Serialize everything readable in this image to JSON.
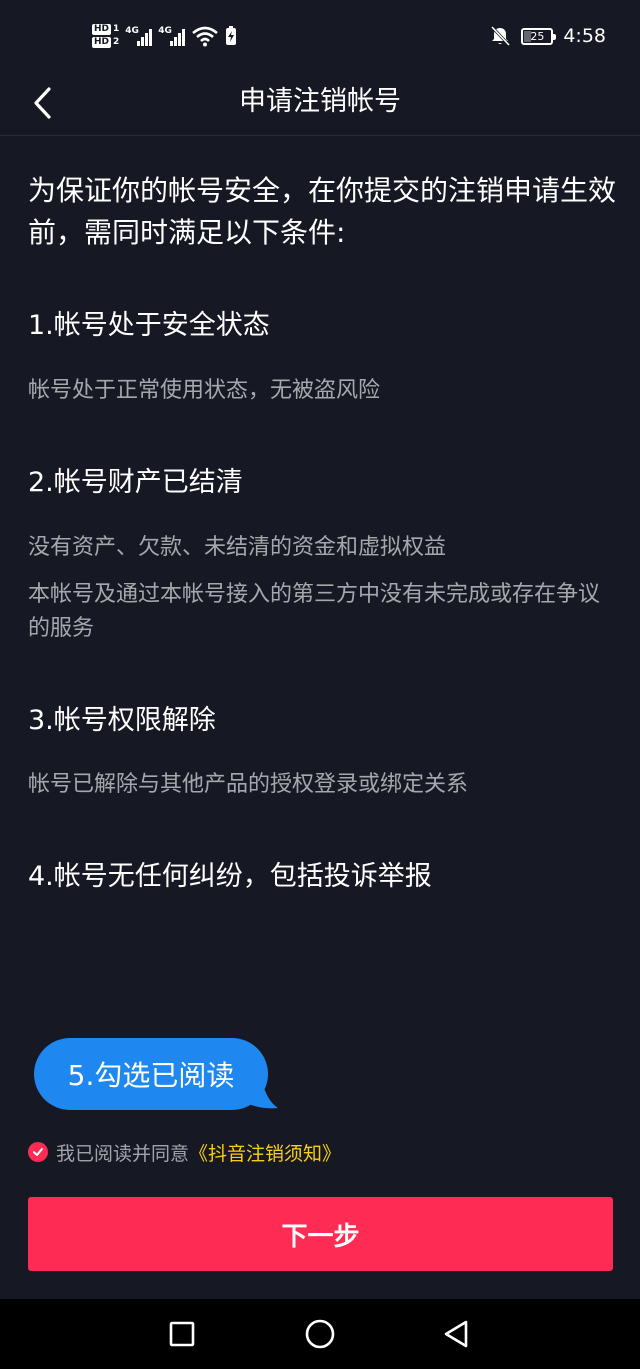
{
  "status_bar": {
    "hd1": "HD",
    "hd1_num": "1",
    "hd2": "HD",
    "hd2_num": "2",
    "net1": "4G",
    "net2": "4G",
    "battery_level": "25",
    "time": "4:58",
    "icons": [
      "signal-icon",
      "wifi-icon",
      "charging-icon",
      "mute-bell-icon",
      "battery-icon"
    ]
  },
  "header": {
    "back_icon": "chevron-left-icon",
    "title": "申请注销帐号"
  },
  "intro": "为保证你的帐号安全，在你提交的注销申请生效前，需同时满足以下条件:",
  "conditions": [
    {
      "title": "1.帐号处于安全状态",
      "descriptions": [
        "帐号处于正常使用状态，无被盗风险"
      ]
    },
    {
      "title": "2.帐号财产已结清",
      "descriptions": [
        "没有资产、欠款、未结清的资金和虚拟权益",
        "本帐号及通过本帐号接入的第三方中没有未完成或存在争议的服务"
      ]
    },
    {
      "title": "3.帐号权限解除",
      "descriptions": [
        "帐号已解除与其他产品的授权登录或绑定关系"
      ]
    },
    {
      "title": "4.帐号无任何纠纷，包括投诉举报",
      "descriptions": []
    }
  ],
  "callout": {
    "text": "5.勾选已阅读",
    "color": "#1e88f0"
  },
  "agreement": {
    "checked": true,
    "prefix": "我已阅读并同意",
    "link": "《抖音注销须知》",
    "link_color": "#face15"
  },
  "next_button": {
    "label": "下一步",
    "color": "#fe2c55"
  },
  "nav_bar": {
    "icons": [
      "recent-apps-icon",
      "home-icon",
      "back-icon"
    ]
  }
}
